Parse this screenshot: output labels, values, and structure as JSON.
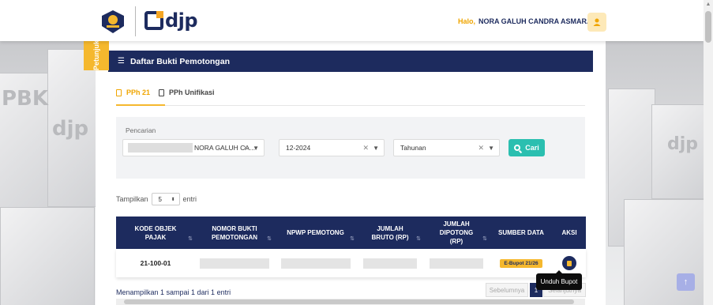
{
  "header": {
    "brand": "djp",
    "greeting": "Halo,",
    "user_name": "NORA GALUH CANDRA ASMARANI"
  },
  "side_tab": {
    "label": "Petunjuk"
  },
  "card": {
    "title": "Daftar Bukti Pemotongan",
    "tabs": [
      {
        "label": "PPh 21",
        "active": true
      },
      {
        "label": "PPh Unifikasi",
        "active": false
      }
    ],
    "search": {
      "label": "Pencarian",
      "name_value": "NORA GALUH CA...",
      "period_value": "12-2024",
      "type_value": "Tahunan",
      "search_button": "Cari"
    },
    "length": {
      "before": "Tampilkan",
      "value": "5",
      "after": "entri"
    },
    "table": {
      "columns": [
        "KODE OBJEK PAJAK",
        "NOMOR BUKTI PEMOTONGAN",
        "NPWP PEMOTONG",
        "JUMLAH BRUTO (RP)",
        "JUMLAH DIPOTONG (RP)",
        "SUMBER DATA",
        "AKSI"
      ],
      "rows": [
        {
          "kode": "21-100-01",
          "nomor": "",
          "npwp": "",
          "bruto": "",
          "dipotong": "",
          "sumber": "E-Bupot 21/26"
        }
      ]
    },
    "tooltip": "Unduh Bupot",
    "info": "Menampilkan 1 sampai 1 dari 1 entri",
    "pagination": {
      "prev": "Sebelumnya",
      "page": "1",
      "next": "Selanjutnya"
    }
  },
  "colors": {
    "navy": "#1d2b5e",
    "accent": "#f5b82e",
    "teal": "#2bbfb0"
  },
  "icons": [
    "emblem-icon",
    "user-icon",
    "list-icon",
    "document-icon",
    "search-icon",
    "download-icon",
    "arrow-up-icon"
  ]
}
